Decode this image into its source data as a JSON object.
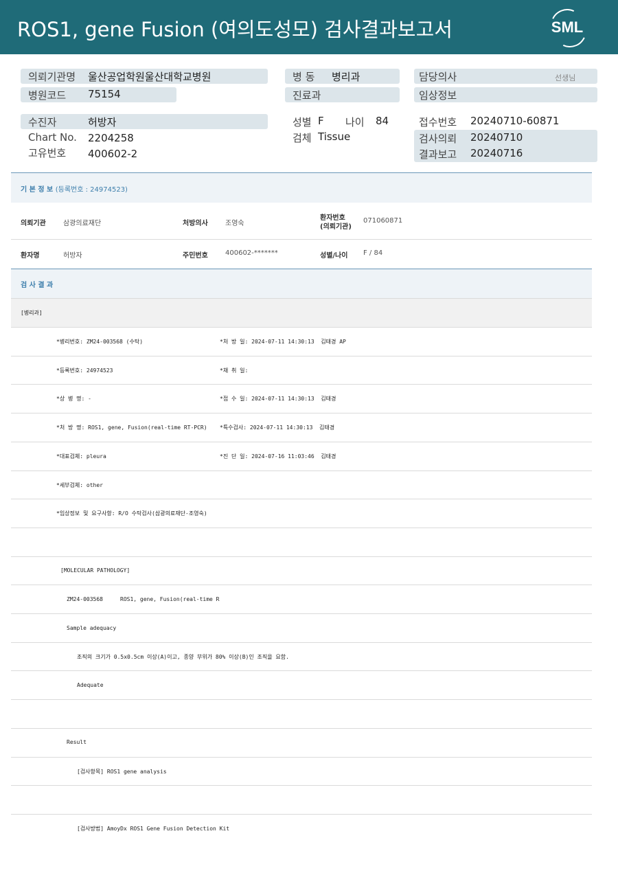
{
  "header": {
    "title": "ROS1, gene Fusion (여의도성모) 검사결과보고서",
    "logo_text": "SML"
  },
  "summary": {
    "requester_label": "의뢰기관명",
    "requester_value": "울산공업학원울산대학교병원",
    "hospital_code_label": "병원코드",
    "hospital_code_value": "75154",
    "ward_label": "병 동",
    "ward_value": "병리과",
    "dept_label": "진료과",
    "dept_value": "",
    "doctor_label": "담당의사",
    "doctor_suffix": "선생님",
    "clinical_label": "임상정보",
    "clinical_value": "",
    "patient_label": "수진자",
    "patient_value": "허방자",
    "chart_label": "Chart No.",
    "chart_value": "2204258",
    "unique_label": "고유번호",
    "unique_value": "400602-2",
    "sex_label": "성별",
    "sex_value": "F",
    "age_label": "나이",
    "age_value": "84",
    "specimen_label": "검체",
    "specimen_value": "Tissue",
    "receipt_label": "접수번호",
    "receipt_value": "20240710-60871",
    "request_label": "검사의뢰",
    "request_value": "20240710",
    "report_label": "결과보고",
    "report_value": "20240716"
  },
  "basic_info": {
    "title": "기 본 정 보",
    "reg": "(등록번호 : 24974523)",
    "inst_label": "의뢰기관",
    "inst_value": "삼광의료재단",
    "rx_doctor_label": "처방의사",
    "rx_doctor_value": "조영숙",
    "pt_no_label_1": "환자번호",
    "pt_no_label_2": "(의뢰기관)",
    "pt_no_value": "071060871",
    "pt_name_label": "환자명",
    "pt_name_value": "허방자",
    "rrn_label": "주민번호",
    "rrn_value": "400602-*******",
    "sexage_label": "성별/나이",
    "sexage_value": "F / 84"
  },
  "results": {
    "title": "검 사 결 과",
    "dept_tag": "[병리과]",
    "lines": [
      {
        "left": "*병리번호: ZM24-003568 (수탁)",
        "right": "*처 방 일: 2024-07-11 14:30:13  김태경 AP"
      },
      {
        "left": "*등록번호: 24974523",
        "right": "*채 취 일:"
      },
      {
        "left": "*상 병 명: -",
        "right": "*접 수 일: 2024-07-11 14:30:13  김태경"
      },
      {
        "left": "*처 방 명: ROS1, gene, Fusion(real-time RT-PCR)",
        "right": "*특수검사: 2024-07-11 14:30:13  김태경"
      },
      {
        "left": "*대표검체: pleura",
        "right": "*진 단 일: 2024-07-16 11:03:46  김태경"
      },
      {
        "left": "*세부검체: other",
        "right": ""
      },
      {
        "left": "*임상정보 및 요구사항: R/O 수탁검사(삼광의료재단-조영숙)",
        "right": ""
      }
    ],
    "mp_header": "[MOLECULAR PATHOLOGY]",
    "mp_code": "ZM24-003568",
    "mp_test": "ROS1, gene, Fusion(real-time R",
    "adequacy_label": "Sample adequacy",
    "adequacy_note": "조직의 크기가 0.5x0.5cm 이상(A)이고, 종양 부위가 80% 이상(B)인 조직을 요함.",
    "adequacy_value": "Adequate",
    "result_label": "Result",
    "item_line": "[검사항목] ROS1 gene analysis",
    "method_line": "[검사방법] AmoyDx ROS1 Gene Fusion Detection Kit"
  },
  "colors": {
    "header_bg": "#1f6b78",
    "label_box": "#dce5ea",
    "section_blue": "#3e7fac"
  }
}
